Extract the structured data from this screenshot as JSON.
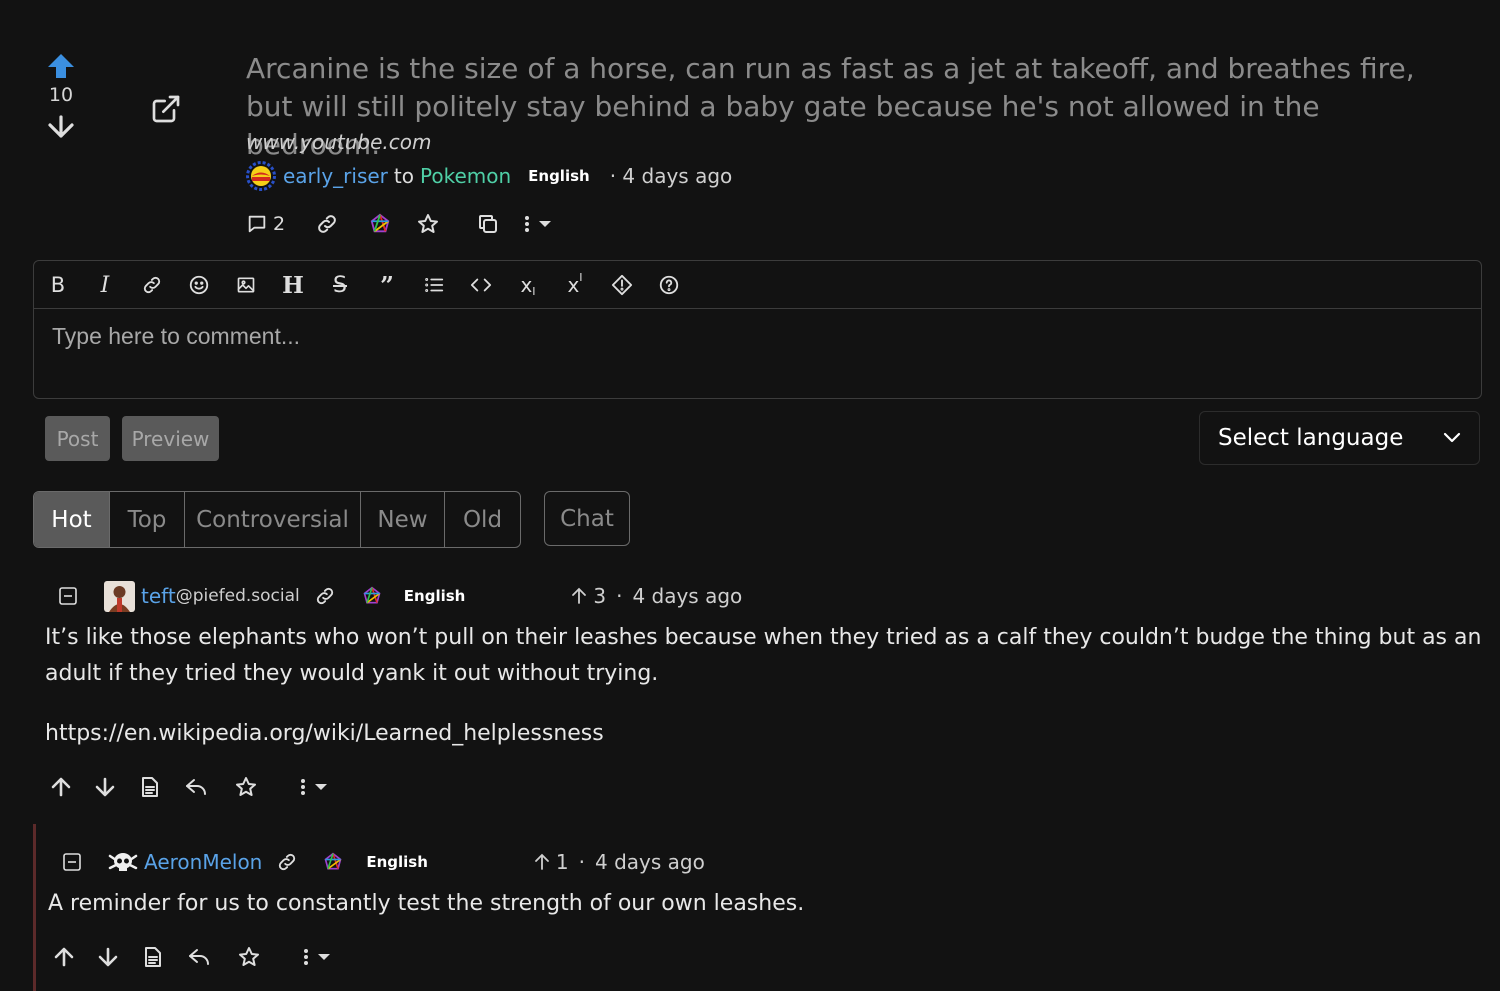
{
  "post": {
    "score": "10",
    "title": "Arcanine is the size of a horse, can run as fast as a jet at takeoff, and breathes fire, but will still politely stay behind a baby gate because he's not allowed in the bedroom.",
    "domain": "www.youtube.com",
    "author": "early_riser",
    "to_label": "to",
    "community": "Pokemon",
    "language": "English",
    "time": "· 4 days ago",
    "comment_count": "2"
  },
  "editor": {
    "placeholder": "Type here to comment...",
    "toolbar_icons": [
      "bold-icon",
      "italic-icon",
      "link-icon",
      "emoji-icon",
      "image-icon",
      "heading-icon",
      "strikethrough-icon",
      "quote-icon",
      "list-icon",
      "code-icon",
      "subscript-icon",
      "superscript-icon",
      "spoiler-icon",
      "help-icon"
    ]
  },
  "form": {
    "post_label": "Post",
    "preview_label": "Preview",
    "language_select": "Select language"
  },
  "sort": {
    "tabs": [
      "Hot",
      "Top",
      "Controversial",
      "New",
      "Old"
    ],
    "active": "Hot",
    "chat_label": "Chat"
  },
  "comments": [
    {
      "author": "teft",
      "instance": "@piefed.social",
      "language": "English",
      "score": "3",
      "separator": "·",
      "time": "4 days ago",
      "body": "It’s like those elephants who won’t pull on their leashes because when they tried as a calf they couldn’t budge the thing but as an adult if they tried they would yank it out without trying.",
      "link": "https://en.wikipedia.org/wiki/Learned_helplessness"
    },
    {
      "author": "AeronMelon",
      "language": "English",
      "score": "1",
      "separator": "·",
      "time": "4 days ago",
      "body": "A reminder for us to constantly test the strength of our own leashes."
    }
  ],
  "colors": {
    "background": "#121212",
    "upvote_active": "#3b8fe0",
    "username": "#5aa3e8",
    "community": "#4fcfa6",
    "thread_line": "#5c2a2a"
  }
}
